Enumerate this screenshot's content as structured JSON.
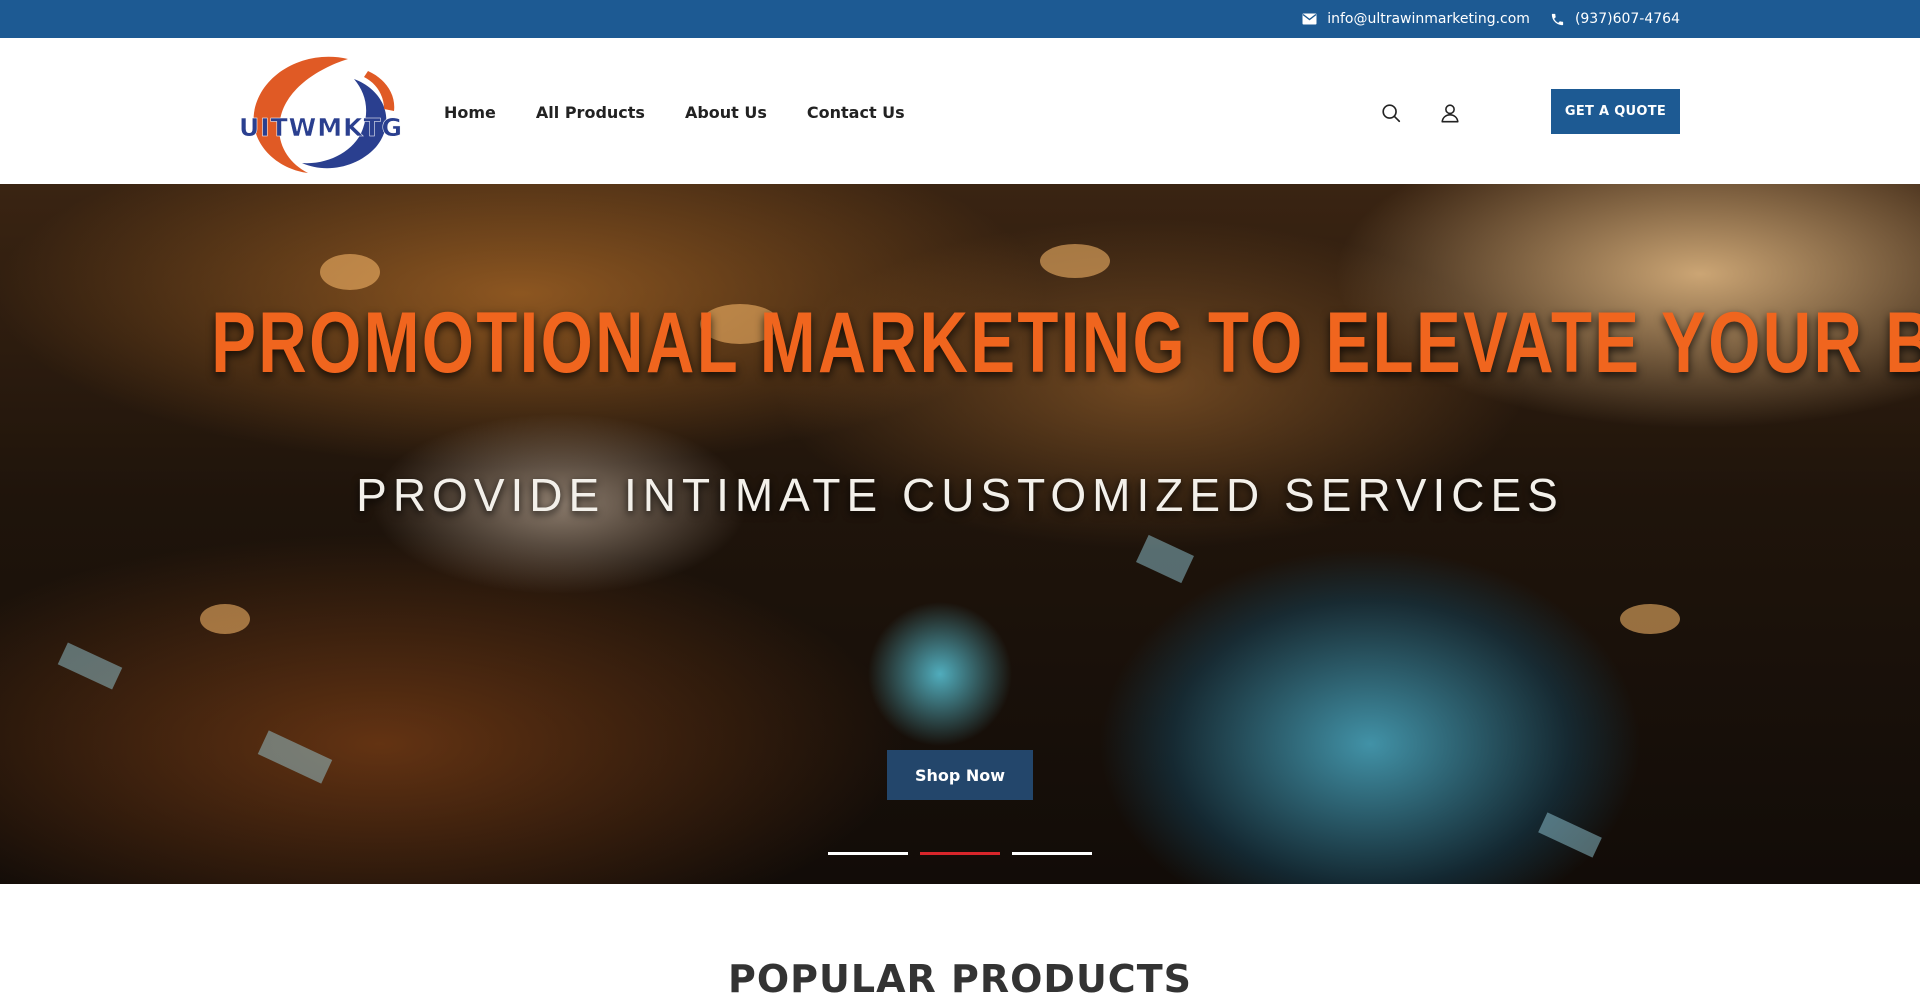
{
  "topbar": {
    "email": "info@ultrawinmarketing.com",
    "phone": "(937)607-4764",
    "email_icon": "envelope-icon",
    "phone_icon": "phone-icon"
  },
  "header": {
    "logo_text": "UITWMKTG",
    "nav": [
      {
        "label": "Home"
      },
      {
        "label": "All Products"
      },
      {
        "label": "About Us"
      },
      {
        "label": "Contact Us"
      }
    ],
    "search_icon": "search-icon",
    "account_icon": "user-icon",
    "quote_button": "GET A QUOTE"
  },
  "hero": {
    "title": "PROMOTIONAL MARKETING TO ELEVATE YOUR BRAND",
    "subtitle": "PROVIDE INTIMATE CUSTOMIZED SERVICES",
    "cta": "Shop Now",
    "slides_total": 3,
    "active_slide": 2
  },
  "section": {
    "title": "POPULAR PRODUCTS"
  },
  "colors": {
    "primary": "#1d5a93",
    "accent_orange": "#f0651e",
    "active_dot": "#d8262b"
  }
}
